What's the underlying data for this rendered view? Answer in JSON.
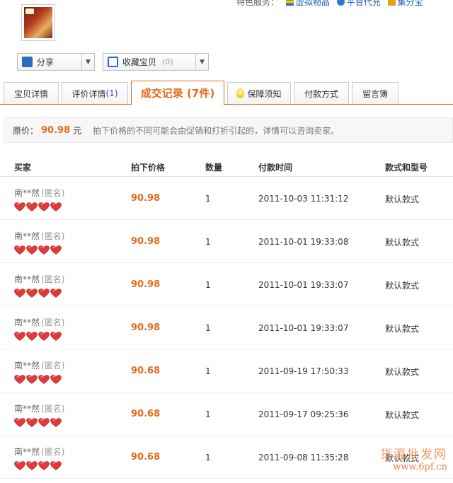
{
  "services": {
    "label": "特色服务：",
    "items": [
      "虚拟物品",
      "平台代充",
      "集分宝"
    ]
  },
  "share": {
    "label": "分享"
  },
  "favorite": {
    "label": "收藏宝贝",
    "count": "(0)"
  },
  "tabs": [
    {
      "label": "宝贝详情"
    },
    {
      "label": "评价详情",
      "num": "(1)"
    },
    {
      "label": "成交记录",
      "num": "(7件)"
    },
    {
      "label": "保障须知"
    },
    {
      "label": "付款方式"
    },
    {
      "label": "留言簿"
    }
  ],
  "price_line": {
    "label": "原价：",
    "value": "90.98",
    "currency": "元",
    "note": "拍下价格的不同可能会由促销和打折引起的，详情可以咨询卖家。"
  },
  "table": {
    "headers": [
      "买家",
      "拍下价格",
      "数量",
      "付款时间",
      "款式和型号"
    ],
    "rows": [
      {
        "buyer": "南**然",
        "anon": "(匿名)",
        "price": "90.98",
        "qty": "1",
        "time": "2011-10-03 11:31:12",
        "style": "默认款式"
      },
      {
        "buyer": "南**然",
        "anon": "(匿名)",
        "price": "90.98",
        "qty": "1",
        "time": "2011-10-01 19:33:08",
        "style": "默认款式"
      },
      {
        "buyer": "南**然",
        "anon": "(匿名)",
        "price": "90.98",
        "qty": "1",
        "time": "2011-10-01 19:33:07",
        "style": "默认款式"
      },
      {
        "buyer": "南**然",
        "anon": "(匿名)",
        "price": "90.98",
        "qty": "1",
        "time": "2011-10-01 19:33:07",
        "style": "默认款式"
      },
      {
        "buyer": "南**然",
        "anon": "(匿名)",
        "price": "90.68",
        "qty": "1",
        "time": "2011-09-19 17:50:33",
        "style": "默认款式"
      },
      {
        "buyer": "南**然",
        "anon": "(匿名)",
        "price": "90.68",
        "qty": "1",
        "time": "2011-09-17 09:25:36",
        "style": "默认款式"
      },
      {
        "buyer": "南**然",
        "anon": "(匿名)",
        "price": "90.68",
        "qty": "1",
        "time": "2011-09-08 11:35:28",
        "style": "默认款式"
      }
    ]
  },
  "watermark": {
    "line1": "货源批发网",
    "line2": "www.6pf.cn"
  },
  "colors": {
    "accent": "#e36a1a",
    "link": "#1d5bb5",
    "heart": "#e03a3a"
  },
  "icons": [
    "share-icon",
    "favorite-icon",
    "bulb-icon",
    "heart-icon",
    "dropdown-arrow-icon"
  ]
}
